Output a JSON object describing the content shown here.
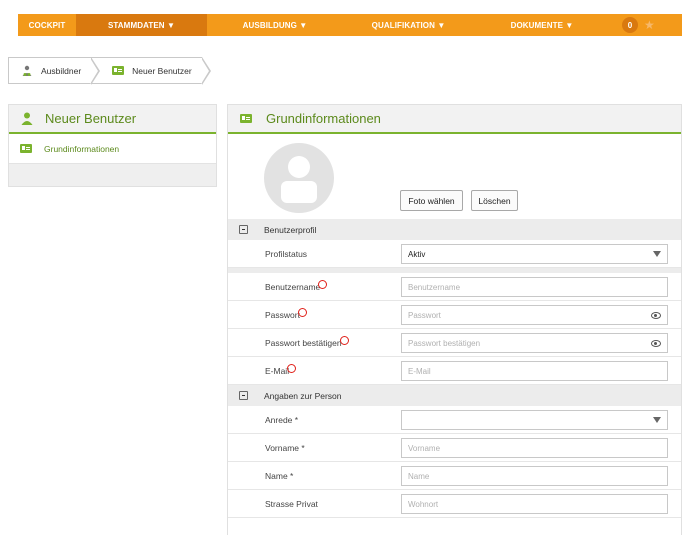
{
  "nav": {
    "items": [
      {
        "label": "COCKPIT",
        "active": false
      },
      {
        "label": "STAMMDATEN ▼",
        "active": true
      },
      {
        "label": "AUSBILDUNG ▼",
        "active": false
      },
      {
        "label": "QUALIFIKATION ▼",
        "active": false
      },
      {
        "label": "DOKUMENTE ▼",
        "active": false
      }
    ],
    "badge_count": "0",
    "star_icon": "star-icon"
  },
  "breadcrumb": {
    "items": [
      {
        "label": "Ausbildner",
        "icon": "users-icon"
      },
      {
        "label": "Neuer Benutzer",
        "icon": "id-card-icon"
      }
    ]
  },
  "left_panel": {
    "title": "Neuer Benutzer",
    "items": [
      {
        "label": "Grundinformationen",
        "icon": "id-card-icon"
      }
    ]
  },
  "main": {
    "title": "Grundinformationen",
    "photo": {
      "choose_label": "Foto wählen",
      "delete_label": "Löschen"
    },
    "sections": {
      "profile": {
        "title": "Benutzerprofil",
        "status_label": "Profilstatus",
        "status_value": "Aktiv"
      },
      "account": {
        "username_label": "Benutzername",
        "username_placeholder": "Benutzername",
        "password_label": "Passwort",
        "password_placeholder": "Passwort",
        "confirm_label": "Passwort bestätigen",
        "confirm_placeholder": "Passwort bestätigen",
        "email_label": "E-Mail",
        "email_placeholder": "E-Mail"
      },
      "person": {
        "title": "Angaben zur Person",
        "salutation_label": "Anrede *",
        "salutation_value": "",
        "firstname_label": "Vorname *",
        "firstname_placeholder": "Vorname",
        "lastname_label": "Name *",
        "lastname_placeholder": "Name",
        "street_label": "Strasse Privat",
        "street_placeholder": "Wohnort"
      }
    }
  },
  "colors": {
    "nav_orange": "#f39a1a",
    "nav_active": "#d9790f",
    "accent_green": "#7bb32e",
    "required_red": "#e0201a"
  }
}
